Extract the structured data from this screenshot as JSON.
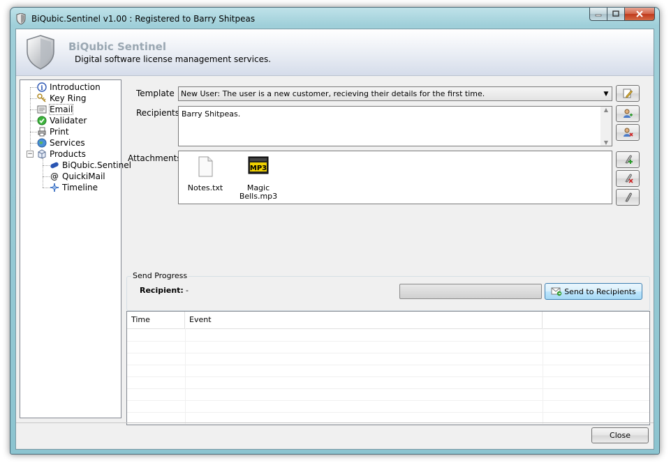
{
  "window": {
    "title": "BiQubic.Sentinel v1.00 : Registered to Barry Shitpeas",
    "minimize_label": "minimize",
    "maximize_label": "maximize",
    "close_label": "close"
  },
  "banner": {
    "title": "BiQubic Sentinel",
    "subtitle": "Digital software license management services."
  },
  "tree": {
    "items": [
      {
        "label": "Introduction",
        "icon": "info-icon"
      },
      {
        "label": "Key Ring",
        "icon": "keys-icon"
      },
      {
        "label": "Email",
        "icon": "email-icon",
        "selected": true
      },
      {
        "label": "Validater",
        "icon": "check-icon"
      },
      {
        "label": "Print",
        "icon": "printer-icon"
      },
      {
        "label": "Services",
        "icon": "globe-icon"
      },
      {
        "label": "Products",
        "icon": "box-icon",
        "expanded": true
      }
    ],
    "children": [
      {
        "label": "BiQubic.Sentinel",
        "icon": "pill-icon"
      },
      {
        "label": "QuickiMail",
        "icon": "at-icon"
      },
      {
        "label": "Timeline",
        "icon": "timeline-icon"
      }
    ]
  },
  "form": {
    "template_label": "Template",
    "template_value": "New User: The user is a new customer, recieving their details for the first time.",
    "recipients_label": "Recipients",
    "recipients_value": "Barry Shitpeas.",
    "attachments_label": "Attachments",
    "attachments": [
      {
        "name": "Notes.txt",
        "icon": "text-file-icon"
      },
      {
        "name": "Magic Bells.mp3",
        "icon": "mp3-file-icon"
      }
    ]
  },
  "send_progress": {
    "legend": "Send Progress",
    "recipient_label": "Recipient:",
    "recipient_value": "-",
    "progress": 0,
    "send_button": "Send to Recipients"
  },
  "log": {
    "columns": [
      "Time",
      "Event",
      ""
    ],
    "rows": []
  },
  "footer": {
    "close_button": "Close"
  },
  "colors": {
    "frame": "#8cc4d0",
    "client": "#f0f0f0",
    "send_button": "#bee6fd",
    "banner_title": "#9aa7b2"
  }
}
